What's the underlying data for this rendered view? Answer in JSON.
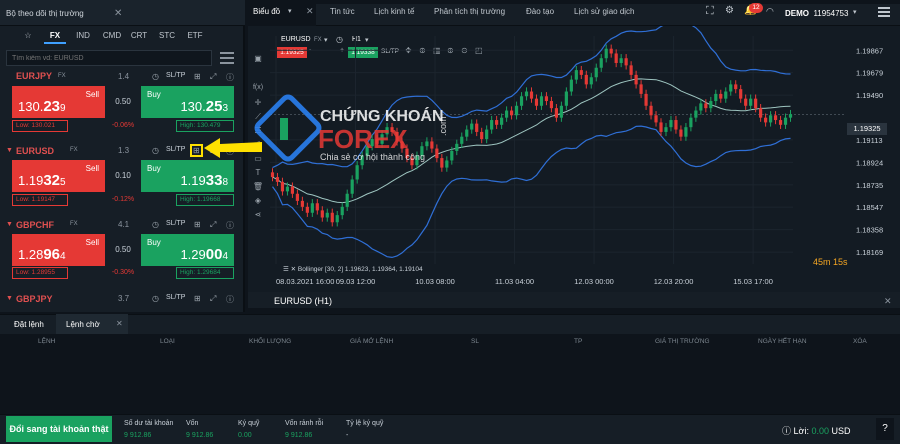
{
  "left_panel": {
    "title": "Bộ theo dõi thị trường",
    "tabs": [
      "☆",
      "FX",
      "IND",
      "CMD",
      "CRT",
      "STC",
      "ETF"
    ],
    "active_tab": "FX",
    "search_placeholder": "Tìm kiếm vd: EURUSD",
    "sltp_label": "SL/TP",
    "sell_label": "Sell",
    "buy_label": "Buy",
    "symbols": [
      {
        "name": "EURJPY",
        "type": "FX",
        "spread": "1.4",
        "sell_main": "130.",
        "sell_big": "23",
        "sell_small": "9",
        "mid": "0.50",
        "buy_main": "130.",
        "buy_big": "25",
        "buy_small": "3",
        "low": "Low: 130.021",
        "high": "High: 130.479",
        "change": "-0.06%"
      },
      {
        "name": "EURUSD",
        "type": "FX",
        "spread": "1.3",
        "sell_main": "1.19",
        "sell_big": "32",
        "sell_small": "5",
        "mid": "0.10",
        "buy_main": "1.19",
        "buy_big": "33",
        "buy_small": "8",
        "low": "Low: 1.19147",
        "high": "High: 1.19668",
        "change": "-0.12%"
      },
      {
        "name": "GBPCHF",
        "type": "FX",
        "spread": "4.1",
        "sell_main": "1.28",
        "sell_big": "96",
        "sell_small": "4",
        "mid": "0.50",
        "buy_main": "1.29",
        "buy_big": "00",
        "buy_small": "4",
        "low": "Low: 1.28955",
        "high": "High: 1.29684",
        "change": "-0.30%"
      },
      {
        "name": "GBPJPY",
        "type": "FX",
        "spread": "3.7"
      }
    ]
  },
  "chart": {
    "tabs": [
      "Biểu đồ",
      "Tin tức",
      "Lịch kinh tế",
      "Phân tích thị trường",
      "Đào tạo",
      "Lịch sử giao dịch"
    ],
    "notification_count": "12",
    "account_type": "DEMO",
    "account_number": "11954753",
    "symbol": "EURUSD",
    "symbol_type": "FX",
    "timeframe": "H1",
    "bid_box": "1.19325",
    "ask_box": "1.19338",
    "sltp_label": "SL/TP",
    "indicator_label": "Bollinger [30, 2] 1.19623, 1.19364, 1.19104",
    "countdown": "45m 15s",
    "current_price_label": "1.19325",
    "footer_label": "EURUSD (H1)",
    "watermark": {
      "line1": "CHỨNG KHOÁN",
      "line2": "FOREX",
      "tld": ".com",
      "tagline": "Chia sẻ cơ hội thành công"
    },
    "colors": {
      "bull": "#1aa260",
      "bear": "#e53935",
      "band": "#2f6fd6",
      "mid": "#9ec5c0"
    }
  },
  "chart_data": {
    "type": "candlestick",
    "title": "",
    "xlabel": "",
    "ylabel": "",
    "ylim": [
      1.18069,
      1.19987
    ],
    "y_ticks": [
      "1.19867",
      "1.19679",
      "1.19490",
      "1.19113",
      "1.18924",
      "1.18735",
      "1.18547",
      "1.18358",
      "1.18169"
    ],
    "x_ticks": [
      "08.03.2021 16:00",
      "09.03 12:00",
      "10.03 08:00",
      "11.03 04:00",
      "12.03 00:00",
      "12.03 20:00",
      "15.03 17:00"
    ],
    "closes": [
      1.188,
      1.1876,
      1.1868,
      1.1872,
      1.1866,
      1.186,
      1.1855,
      1.185,
      1.1858,
      1.1852,
      1.1846,
      1.185,
      1.1842,
      1.1848,
      1.1855,
      1.1866,
      1.1878,
      1.189,
      1.1898,
      1.1906,
      1.1912,
      1.1908,
      1.1916,
      1.1922,
      1.1918,
      1.191,
      1.1904,
      1.1896,
      1.189,
      1.1898,
      1.1906,
      1.191,
      1.1904,
      1.1896,
      1.1888,
      1.1894,
      1.1902,
      1.1908,
      1.1914,
      1.192,
      1.1925,
      1.1918,
      1.1912,
      1.192,
      1.1928,
      1.1924,
      1.193,
      1.1936,
      1.1932,
      1.194,
      1.1948,
      1.1952,
      1.1946,
      1.194,
      1.1948,
      1.1944,
      1.1938,
      1.193,
      1.194,
      1.1952,
      1.1962,
      1.197,
      1.1966,
      1.1958,
      1.1964,
      1.1972,
      1.198,
      1.1988,
      1.1984,
      1.1976,
      1.198,
      1.1974,
      1.1966,
      1.1958,
      1.195,
      1.194,
      1.1932,
      1.1926,
      1.1918,
      1.1922,
      1.1928,
      1.192,
      1.1914,
      1.1922,
      1.193,
      1.1936,
      1.1942,
      1.1938,
      1.1944,
      1.195,
      1.1946,
      1.1952,
      1.1958,
      1.1954,
      1.1946,
      1.194,
      1.1946,
      1.1938,
      1.193,
      1.1926,
      1.1932,
      1.1928,
      1.1924,
      1.193,
      1.1933
    ]
  },
  "bottom": {
    "tabs": [
      "Đặt lệnh",
      "Lệnh chờ"
    ],
    "columns": [
      "LỆNH",
      "LOẠI",
      "KHỐI LƯỢNG",
      "GIÁ MỞ LỆNH",
      "SL",
      "TP",
      "GIÁ THỊ TRƯỜNG",
      "NGÀY HẾT HẠN",
      "XÓA"
    ],
    "real_account_button": "Đổi sang tài khoản thật",
    "account": [
      {
        "label": "Số dư tài khoản",
        "value": "9 912.86"
      },
      {
        "label": "Vốn",
        "value": "9 912.86"
      },
      {
        "label": "Ký quỹ",
        "value": "0.00"
      },
      {
        "label": "Vốn rảnh rỗi",
        "value": "9 912.86"
      },
      {
        "label": "Tỷ lệ ký quỹ",
        "value": "-"
      }
    ],
    "profit_label": "Lời:",
    "profit_value": "0.00",
    "profit_currency": "USD",
    "help": "?"
  }
}
